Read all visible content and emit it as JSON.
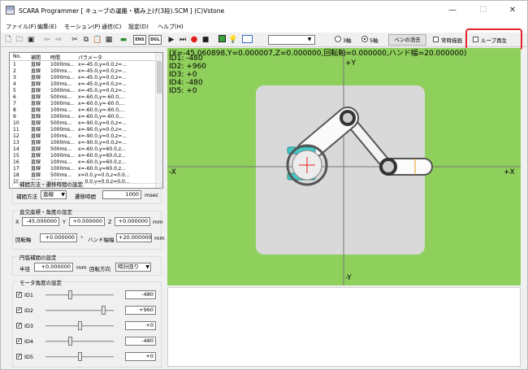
{
  "window": {
    "title": "SCARA Programmer [ キューブの運搬・積み上げ(3段).SCM ]   (C)Vstone",
    "controls": [
      "—",
      "☐",
      "✕"
    ]
  },
  "menu": [
    "ファイル(F)",
    "編集(E)",
    "モーション(P)",
    "通信(C)",
    "設定(D)",
    "ヘルプ(H)"
  ],
  "toolbar": {
    "ens_label": "ENS",
    "dgl_label": "DGL",
    "axis3_label": "3軸",
    "axis5_label": "5軸",
    "axis_selected": "5軸",
    "clear_pen_label": "ペンの消去",
    "always_draw_label": "常時描画",
    "always_draw_checked": false,
    "loop_play_label": "ループ再生",
    "loop_play_checked": false
  },
  "table": {
    "headers": [
      "No.",
      "補間",
      "時間",
      "パラメータ"
    ],
    "rows": [
      {
        "no": "1",
        "interp": "直線",
        "time": "1000ms...",
        "param": "x=-45.0,y=0.0,z=..."
      },
      {
        "no": "2",
        "interp": "直線",
        "time": "100ms...",
        "param": "x=-45.0,y=0.0,z=..."
      },
      {
        "no": "3",
        "interp": "直線",
        "time": "1000ms...",
        "param": "x=-45.0,y=0.0,z=..."
      },
      {
        "no": "4",
        "interp": "直線",
        "time": "100ms...",
        "param": "x=-45.0,y=0.0,z=..."
      },
      {
        "no": "5",
        "interp": "直線",
        "time": "1000ms...",
        "param": "x=-45.0,y=0.0,z=..."
      },
      {
        "no": "6",
        "interp": "直線",
        "time": "500ms...",
        "param": "x=-60.0,y=-60.0,..."
      },
      {
        "no": "7",
        "interp": "直線",
        "time": "1000ms...",
        "param": "x=-60.0,y=-60.0,..."
      },
      {
        "no": "8",
        "interp": "直線",
        "time": "100ms...",
        "param": "x=-60.0,y=-60.0,..."
      },
      {
        "no": "9",
        "interp": "直線",
        "time": "1000ms...",
        "param": "x=-60.0,y=-60.0,..."
      },
      {
        "no": "10",
        "interp": "直線",
        "time": "500ms...",
        "param": "x=-90.0,y=0.0,z=..."
      },
      {
        "no": "11",
        "interp": "直線",
        "time": "1000ms...",
        "param": "x=-90.0,y=0.0,z=..."
      },
      {
        "no": "12",
        "interp": "直線",
        "time": "100ms...",
        "param": "x=-90.0,y=0.0,z=..."
      },
      {
        "no": "13",
        "interp": "直線",
        "time": "1000ms...",
        "param": "x=-90.0,y=0.0,z=..."
      },
      {
        "no": "14",
        "interp": "直線",
        "time": "500ms...",
        "param": "x=-60.0,y=60.0,z..."
      },
      {
        "no": "15",
        "interp": "直線",
        "time": "1000ms...",
        "param": "x=-60.0,y=60.0,z..."
      },
      {
        "no": "16",
        "interp": "直線",
        "time": "100ms...",
        "param": "x=-60.0,y=60.0,z..."
      },
      {
        "no": "17",
        "interp": "直線",
        "time": "1000ms...",
        "param": "x=-60.0,y=60.0,z..."
      },
      {
        "no": "18",
        "interp": "直線",
        "time": "500ms...",
        "param": "x=0.0,y=0.0,z=0.0..."
      },
      {
        "no": "19",
        "interp": "直線",
        "time": "1000ms...",
        "param": "x=0.0,y=0.0,z=0.0..."
      }
    ]
  },
  "interp_group": {
    "title": "補間方法・遷移時間の設定",
    "method_label": "補間方法",
    "method_value": "直線",
    "time_label": "遷移時間",
    "time_value": "1000",
    "time_unit": "msec"
  },
  "coord_group": {
    "title": "直交座標・角度の設定",
    "x_label": "X",
    "x_value": "-45.000000",
    "y_label": "Y",
    "y_value": "+0.000000",
    "z_label": "Z",
    "z_value": "+0.000000",
    "unit_mm": "mm",
    "rot_label": "回転軸",
    "rot_value": "+0.000000",
    "rot_unit": "°",
    "hand_label": "ハンド幅幅",
    "hand_value": "+20.000000",
    "hand_unit": "mm"
  },
  "circle_group": {
    "title": "円弧補間の設定",
    "radius_label": "半径",
    "radius_value": "+0.000000",
    "radius_unit": "mm",
    "dir_label": "回転方向",
    "dir_value": "時計回り"
  },
  "motor_group": {
    "title": "モータ角度の設定",
    "motors": [
      {
        "label": "ID1",
        "checked": true,
        "value": "-480",
        "level": 0.36
      },
      {
        "label": "ID2",
        "checked": true,
        "value": "+960",
        "level": 0.85
      },
      {
        "label": "ID3",
        "checked": true,
        "value": "+0",
        "level": 0.5
      },
      {
        "label": "ID4",
        "checked": true,
        "value": "-480",
        "level": 0.36
      },
      {
        "label": "ID5",
        "checked": true,
        "value": "+0",
        "level": 0.5
      }
    ]
  },
  "canvas": {
    "bg_color": "#8fcf5c",
    "status": "(X=-45.060898,Y=0.000007,Z=0.000000,回転軸=0.000000,ハンド幅=20.000000)",
    "ids": [
      "ID1:  -480",
      "ID2:  +960",
      "ID3:    +0",
      "ID4:  -480",
      "ID5:    +0"
    ],
    "axis_px": "+X",
    "axis_nx": "-X",
    "axis_py": "+Y",
    "axis_ny": "-Y"
  },
  "colors": {
    "highlight": "#e8232a",
    "record_dot": "#e0201c",
    "green_button": "#3aa43a",
    "yellow_bulb": "#f0d000"
  },
  "icons": [
    "app-icon",
    "new-file-icon",
    "open-file-icon",
    "save-icon",
    "undo-icon",
    "redo-icon",
    "cut-icon",
    "copy-icon",
    "paste-icon",
    "grid-icon",
    "plug-icon",
    "play-icon",
    "play-all-icon",
    "record-icon",
    "stop-icon",
    "green-square-icon",
    "bulb-icon",
    "graph-icon"
  ]
}
